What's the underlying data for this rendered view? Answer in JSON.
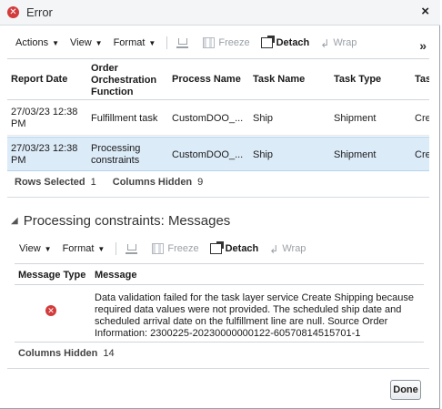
{
  "dialog": {
    "title": "Error",
    "close_label": "×",
    "done_label": "Done"
  },
  "toolbar1": {
    "actions_label": "Actions",
    "view_label": "View",
    "format_label": "Format",
    "freeze_label": "Freeze",
    "detach_label": "Detach",
    "wrap_label": "Wrap",
    "overflow_label": "»"
  },
  "table1": {
    "headers": {
      "report_date": "Report Date",
      "orch_function": [
        "Order",
        "Orchestration",
        "Function"
      ],
      "process_name": "Process Name",
      "task_name": "Task Name",
      "task_type": "Task Type",
      "task_status": "Tas"
    },
    "rows": [
      {
        "report_date": [
          "27/03/23 12:38",
          "PM"
        ],
        "function": [
          "Fulfillment task"
        ],
        "process": "CustomDOO_...",
        "task_name": "Ship",
        "task_type": "Shipment",
        "status": "Cre"
      },
      {
        "report_date": [
          "27/03/23 12:38",
          "PM"
        ],
        "function": [
          "Processing",
          "constraints"
        ],
        "process": "CustomDOO_...",
        "task_name": "Ship",
        "task_type": "Shipment",
        "status": "Cre"
      }
    ],
    "status": {
      "rows_selected_label": "Rows Selected",
      "rows_selected_value": "1",
      "columns_hidden_label": "Columns Hidden",
      "columns_hidden_value": "9"
    }
  },
  "messages_section": {
    "title": "Processing constraints: Messages",
    "toolbar": {
      "view_label": "View",
      "format_label": "Format",
      "freeze_label": "Freeze",
      "detach_label": "Detach",
      "wrap_label": "Wrap"
    },
    "headers": {
      "message_type": "Message Type",
      "message": "Message"
    },
    "rows": [
      {
        "message": "Data validation failed for the task layer service Create Shipping because required data values were not provided. The scheduled ship date and scheduled arrival date on the fulfillment line are null. Source Order Information: 2300225-20230000000122-60570814515701-1"
      }
    ],
    "status": {
      "columns_hidden_label": "Columns Hidden",
      "columns_hidden_value": "14"
    }
  },
  "colors": {
    "error_red": "#d23b3b",
    "selected_row": "#dcebf8",
    "disabled_text": "#9aa0a6"
  }
}
